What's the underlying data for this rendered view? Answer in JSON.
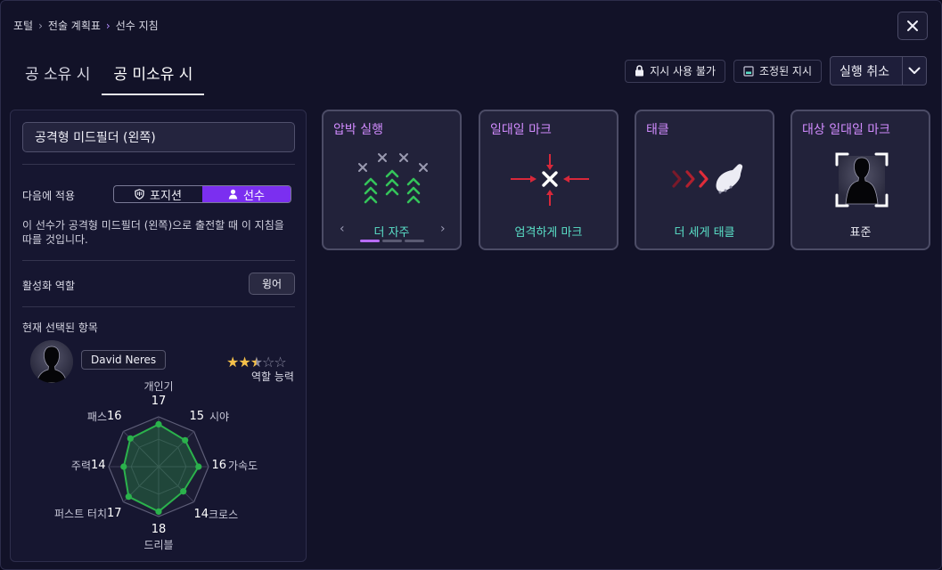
{
  "breadcrumb": {
    "items": [
      "포털",
      "전술 계획표",
      "선수 지침"
    ]
  },
  "tabs": [
    {
      "label": "공 소유 시",
      "active": false
    },
    {
      "label": "공 미소유 시",
      "active": true
    }
  ],
  "toolbar": {
    "locked_label": "지시 사용 불가",
    "adjusted_label": "조정된 지시",
    "undo_label": "실행 취소"
  },
  "left": {
    "role_value": "공격형 미드필더 (왼쪽)",
    "apply_label": "다음에 적용",
    "apply_options": [
      {
        "label": "포지션",
        "active": false
      },
      {
        "label": "선수",
        "active": true
      }
    ],
    "description": "이 선수가 공격형 미드필더 (왼쪽)으로 출전할 때 이 지침을 따를 것입니다.",
    "active_role_label": "활성화 역할",
    "active_role_value": "윙어",
    "selected_label": "현재 선택된 항목",
    "player_name": "David Neres",
    "role_ability_label": "역할 능력",
    "star_rating": 2.5,
    "attributes": [
      {
        "name": "개인기",
        "value": 17
      },
      {
        "name": "시야",
        "value": 15
      },
      {
        "name": "가속도",
        "value": 16
      },
      {
        "name": "크로스",
        "value": 14
      },
      {
        "name": "드리블",
        "value": 18
      },
      {
        "name": "퍼스트 터치",
        "value": 17
      },
      {
        "name": "주력",
        "value": 14
      },
      {
        "name": "패스",
        "value": 16
      }
    ]
  },
  "cards": [
    {
      "title": "압박 실행",
      "value": "더 자주",
      "value_color": "#5ae0c8",
      "icon": "pressing-chevrons-icon",
      "page": 1,
      "pages": 3
    },
    {
      "title": "일대일 마크",
      "value": "엄격하게 마크",
      "value_color": "#5ae0c8",
      "icon": "man-marking-cross-icon"
    },
    {
      "title": "태클",
      "value": "더 세게 태클",
      "value_color": "#5ae0c8",
      "icon": "tackle-boot-icon"
    },
    {
      "title": "대상 일대일 마크",
      "value": "표준",
      "value_color": "#ececf4",
      "icon": "target-player-frame-icon"
    }
  ],
  "colors": {
    "accent": "#7b2ff0",
    "card_title": "#d28cff",
    "positive_value": "#5ae0c8",
    "radar_fill": "#2bb24c",
    "star": "#f5c04a"
  }
}
